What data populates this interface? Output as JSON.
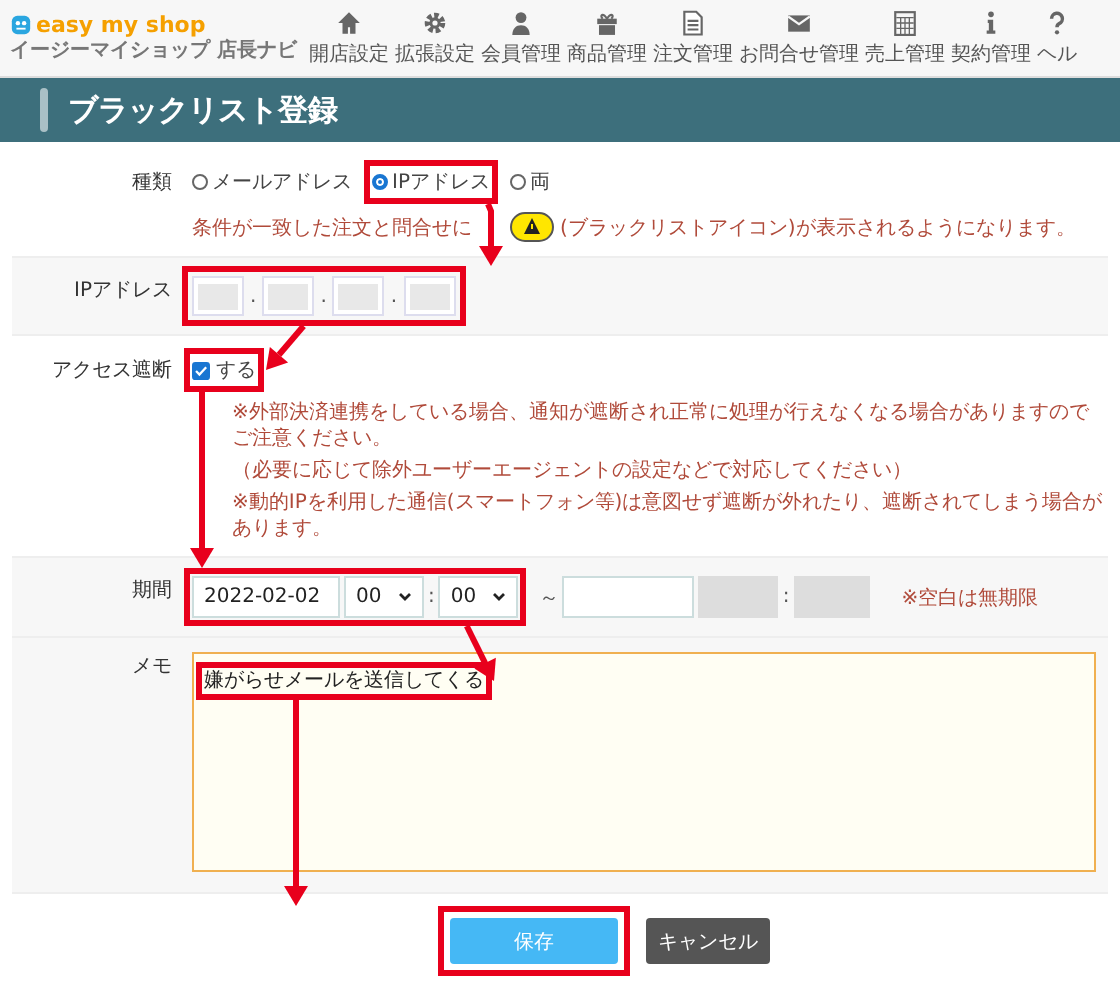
{
  "header": {
    "brand": "easy my shop",
    "subtitle": "イージーマイショップ 店長ナビ",
    "nav": [
      {
        "label": "開店設定"
      },
      {
        "label": "拡張設定"
      },
      {
        "label": "会員管理"
      },
      {
        "label": "商品管理"
      },
      {
        "label": "注文管理"
      },
      {
        "label": "お問合せ管理"
      },
      {
        "label": "売上管理"
      },
      {
        "label": "契約管理"
      },
      {
        "label": "ヘル"
      }
    ]
  },
  "page_title": "ブラックリスト登録",
  "form": {
    "type_row": {
      "label": "種類",
      "options": [
        {
          "label": "メールアドレス",
          "selected": false
        },
        {
          "label": "IPアドレス",
          "selected": true
        },
        {
          "label": "両",
          "selected": false
        }
      ],
      "note_before": "条件が一致した注文と問合せに",
      "note_after": "(ブラックリストアイコン)が表示されるようになります。"
    },
    "ip_row": {
      "label": "IPアドレス",
      "separators": [
        ".",
        ".",
        "."
      ]
    },
    "block_row": {
      "label": "アクセス遮断",
      "checkbox": {
        "label": "する",
        "checked": true
      },
      "notes": [
        "※外部決済連携をしている場合、通知が遮断され正常に処理が行えなくなる場合がありますのでご注意ください。",
        "（必要に応じて除外ユーザーエージェントの設定などで対応してください）",
        "※動的IPを利用した通信(スマートフォン等)は意図せず遮断が外れたり、遮断されてしまう場合があります。"
      ]
    },
    "period_row": {
      "label": "期間",
      "start_date": "2022-02-02",
      "start_hour": "00",
      "start_minute": "00",
      "time_separator": ":",
      "range_separator": "～",
      "end_time_separator": ":",
      "note": "※空白は無期限"
    },
    "memo_row": {
      "label": "メモ",
      "value": "嫌がらせメールを送信してくる"
    }
  },
  "buttons": [
    {
      "label": "保存",
      "kind": "primary"
    },
    {
      "label": "キャンセル",
      "kind": "secondary"
    }
  ]
}
